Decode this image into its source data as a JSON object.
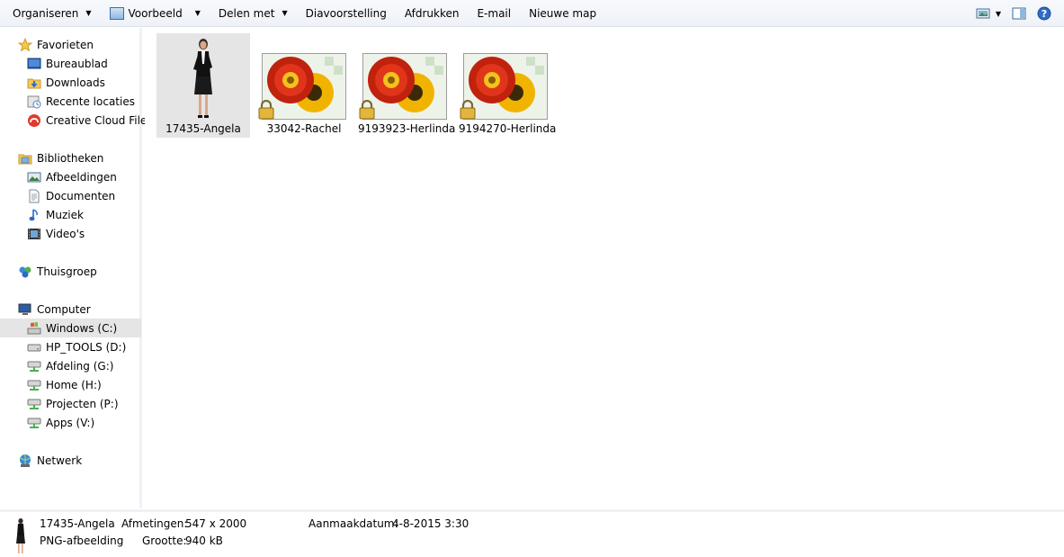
{
  "toolbar": {
    "organize": "Organiseren",
    "preview": "Voorbeeld",
    "share": "Delen met",
    "slideshow": "Diavoorstelling",
    "print": "Afdrukken",
    "email": "E-mail",
    "new_folder": "Nieuwe map"
  },
  "nav": {
    "favorites": "Favorieten",
    "desktop": "Bureaublad",
    "downloads": "Downloads",
    "recent": "Recente locaties",
    "creative_cloud": "Creative Cloud Files",
    "libraries": "Bibliotheken",
    "pictures": "Afbeeldingen",
    "documents": "Documenten",
    "music": "Muziek",
    "videos": "Video's",
    "homegroup": "Thuisgroep",
    "computer": "Computer",
    "drive_c": "Windows  (C:)",
    "drive_d": "HP_TOOLS (D:)",
    "drive_g": "Afdeling (G:)",
    "drive_h": "Home (H:)",
    "drive_p": "Projecten (P:)",
    "drive_v": "Apps (V:)",
    "network": "Netwerk"
  },
  "files": [
    {
      "name": "17435-Angela"
    },
    {
      "name": "33042-Rachel"
    },
    {
      "name": "9193923-Herlinda"
    },
    {
      "name": "9194270-Herlinda"
    }
  ],
  "details": {
    "name": "17435-Angela",
    "type": "PNG-afbeelding",
    "dimensions_label": "Afmetingen:",
    "dimensions_value": "547 x 2000",
    "size_label": "Grootte:",
    "size_value": "940 kB",
    "created_label": "Aanmaakdatum:",
    "created_value": "4-8-2015 3:30"
  }
}
